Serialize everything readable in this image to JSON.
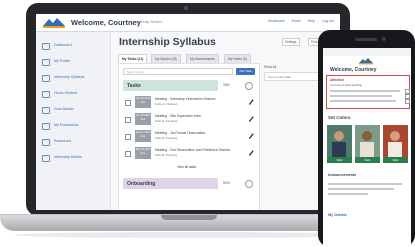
{
  "laptop": {
    "header": {
      "welcome": "Welcome, Courtney",
      "subtitle": "Internship Student",
      "links": [
        "Bookmark",
        "Email",
        "Help",
        "Log out"
      ]
    },
    "sidebar": {
      "items": [
        "Dashboard",
        "My Profile",
        "Internship Syllabus",
        "Hours Worked",
        "Goal Builder",
        "My Evaluations",
        "Resources",
        "Internship Details"
      ]
    },
    "main": {
      "title": "Internship Syllabus",
      "buttons": [
        "Settings",
        "Print"
      ],
      "tabs": [
        "My Tasks (12)",
        "My Student (8)",
        "My Assessments",
        "My Notes (3)"
      ],
      "search_placeholder": "Search tasks",
      "add_label": "Add Task",
      "filter_label": "Show All",
      "filter_select": "Sort by Due Date",
      "sections": [
        {
          "title": "Tasks",
          "percent": "33%",
          "tasks": [
            {
              "date": "Jan 14 2021 Due",
              "title": "Meeting - Internship Orientation Session",
              "status": "Submit: Finished"
            },
            {
              "date": "Jan 28 2021 Due",
              "title": "Meeting - Site Supervisor Intro",
              "status": "Submit: Finished"
            },
            {
              "date": "Feb 11 2021 Due",
              "title": "Meeting - 1st Formal Observation",
              "status": "Submit: Pending"
            },
            {
              "date": "Mar 04 2021 Due",
              "title": "Meeting - 2nd Observation and Feedback Session",
              "status": "Submit: Pending"
            }
          ],
          "view_all": "View all tasks"
        },
        {
          "title": "Onboarding",
          "percent": "50%"
        }
      ]
    }
  },
  "phone": {
    "welcome": "Welcome, Courtney",
    "alert_title": "Attention",
    "alert_sub": "You have 2 tasks pending",
    "colors_title": "Set Colors",
    "cards": [
      "Stick",
      "Stick",
      "Stick"
    ],
    "announcements": "Announcements",
    "bottom_link": "My Details"
  },
  "colors": {
    "accent": "#3b6fc0",
    "tasks_header": "#cfe4dc",
    "onboarding_header": "#ddd4e8",
    "alert_border": "#d8484b",
    "badge": "#2e7d4f"
  }
}
